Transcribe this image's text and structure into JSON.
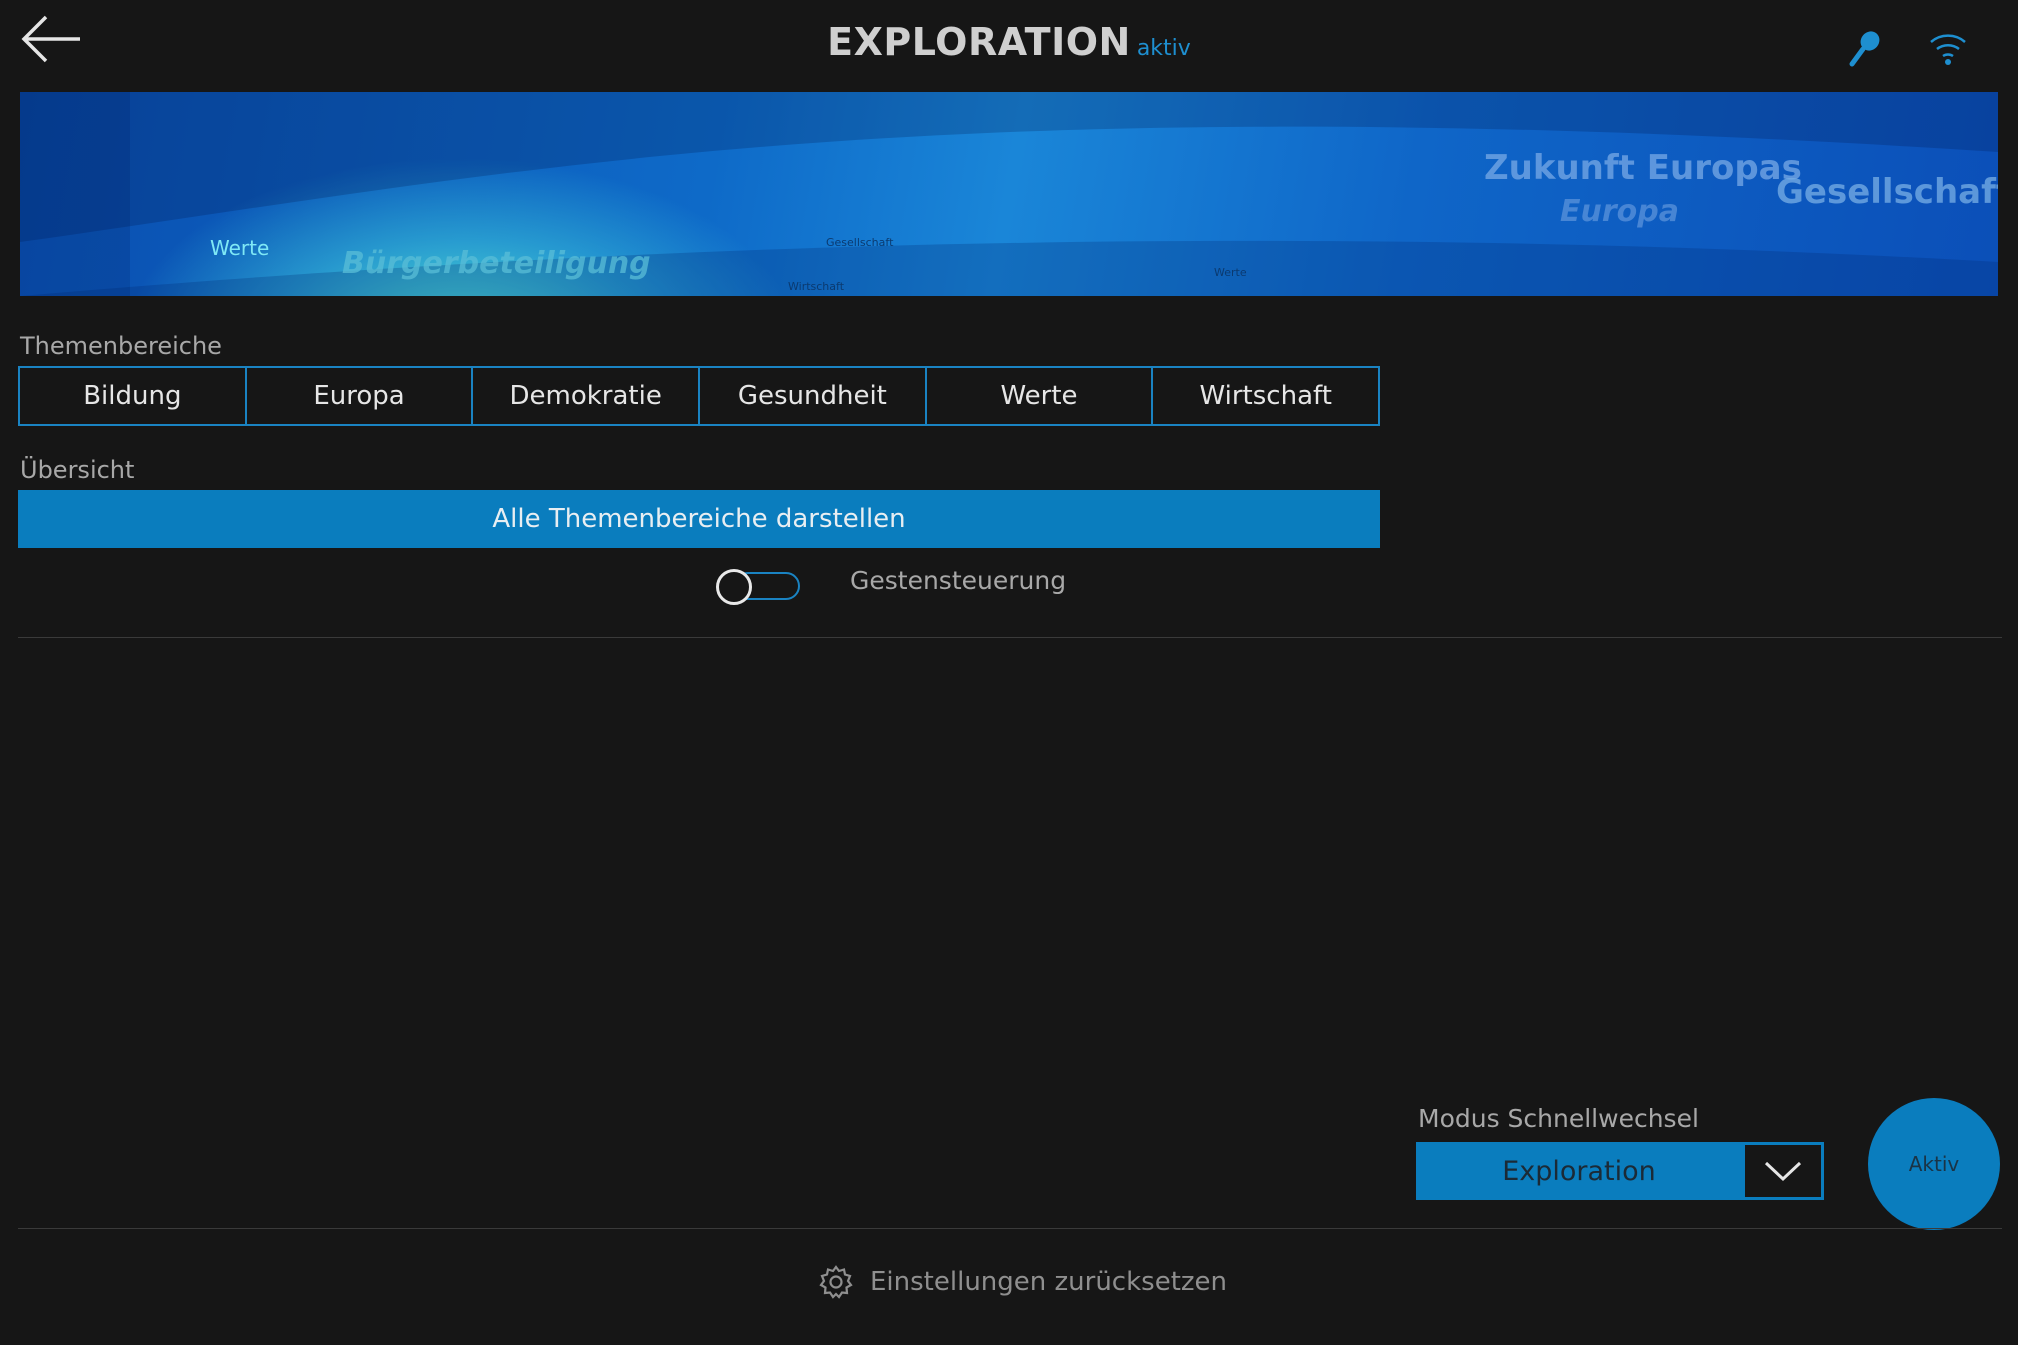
{
  "header": {
    "title": "EXPLORATION",
    "status": "aktiv",
    "icons": [
      "arrow-left-icon",
      "microphone-icon",
      "wifi-icon"
    ]
  },
  "banner": {
    "words": [
      "Zukunft Europas",
      "Europa",
      "Gesellschaft",
      "Werte",
      "Bürgerbeteiligung",
      "Gesellschaft",
      "Wirtschaft",
      "Werte"
    ]
  },
  "themes": {
    "label": "Themenbereiche",
    "items": [
      "Bildung",
      "Europa",
      "Demokratie",
      "Gesundheit",
      "Werte",
      "Wirtschaft"
    ]
  },
  "overview": {
    "label": "Übersicht",
    "button": "Alle Themenbereiche darstellen"
  },
  "gesture": {
    "label": "Gestensteuerung",
    "enabled": false
  },
  "mode": {
    "label": "Modus Schnellwechsel",
    "value": "Exploration",
    "button": "Aktiv"
  },
  "reset": {
    "label": "Einstellungen zurücksetzen",
    "icon": "gear-icon"
  },
  "colors": {
    "background": "#161616",
    "accent": "#0a7dbe",
    "accent_text": "#1e8fd0",
    "text": "#d8d8d8",
    "muted": "#a8a8a8"
  }
}
